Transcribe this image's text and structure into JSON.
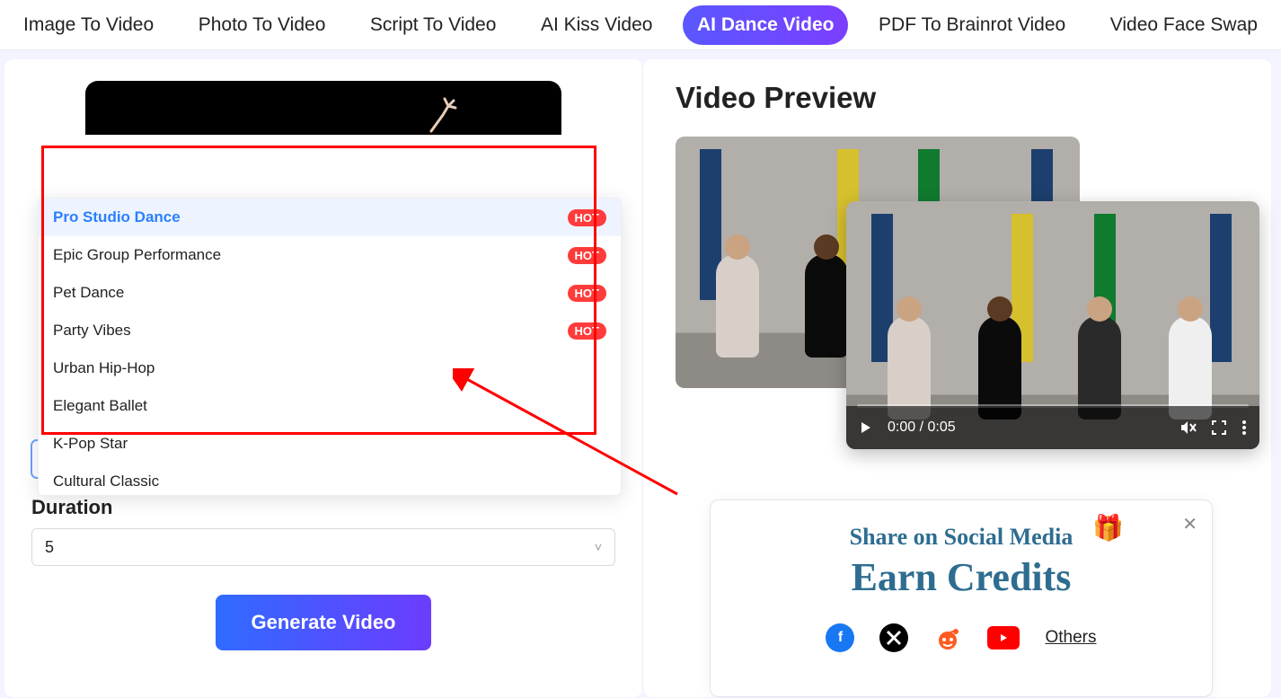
{
  "tabs": [
    {
      "label": "Image To Video"
    },
    {
      "label": "Photo To Video"
    },
    {
      "label": "Script To Video"
    },
    {
      "label": "AI Kiss Video"
    },
    {
      "label": "AI Dance Video",
      "active": true
    },
    {
      "label": "PDF To Brainrot Video"
    },
    {
      "label": "Video Face Swap"
    }
  ],
  "left": {
    "styleSelect": {
      "value": "Pro Studio Dance"
    },
    "durationLabel": "Duration",
    "durationSelect": {
      "value": "5"
    },
    "generateLabel": "Generate Video",
    "styleOptions": [
      {
        "name": "Pro Studio Dance",
        "hot": true,
        "selected": true
      },
      {
        "name": "Epic Group Performance",
        "hot": true
      },
      {
        "name": "Pet Dance",
        "hot": true
      },
      {
        "name": "Party Vibes",
        "hot": true
      },
      {
        "name": "Urban Hip-Hop"
      },
      {
        "name": "Elegant Ballet"
      },
      {
        "name": "K-Pop Star"
      },
      {
        "name": "Cultural Classic"
      }
    ],
    "hotBadge": "HOT"
  },
  "right": {
    "previewTitle": "Video Preview",
    "player": {
      "time": "0:00 / 0:05"
    }
  },
  "share": {
    "line1": "Share on Social Media",
    "line2": "Earn Credits",
    "othersLabel": "Others"
  }
}
